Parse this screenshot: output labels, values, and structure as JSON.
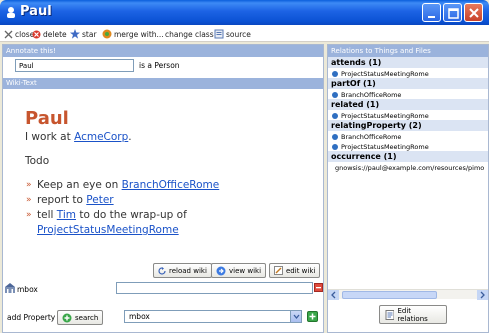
{
  "window": {
    "title": "Paul"
  },
  "toolbar": [
    {
      "label": "close",
      "icon": "close-icon"
    },
    {
      "label": "delete",
      "icon": "delete-icon"
    },
    {
      "label": "star",
      "icon": "star-icon"
    },
    {
      "label": "merge with...",
      "icon": "merge-icon"
    },
    {
      "label": "change class",
      "icon": ""
    },
    {
      "label": "source",
      "icon": "source-icon"
    }
  ],
  "annotate": {
    "header": "Annotate this!",
    "name_value": "Paul",
    "is_a": "is a Person"
  },
  "wiki": {
    "header": "Wiki-Text",
    "title": "Paul",
    "line_prefix": "I work at ",
    "line_link": "AcmeCorp",
    "line_suffix": ".",
    "todo": "Todo",
    "items": [
      {
        "prefix": "Keep an eye on ",
        "link": "BranchOfficeRome",
        "suffix": ""
      },
      {
        "prefix": "report to ",
        "link": "Peter",
        "suffix": ""
      },
      {
        "prefix": "tell ",
        "link": "Tim",
        "suffix": " to do the wrap-up of"
      }
    ],
    "continuation_link": "ProjectStatusMeetingRome",
    "buttons": {
      "reload": "reload wiki",
      "view": "view wiki",
      "edit": "edit wiki"
    }
  },
  "property": {
    "label": "mbox",
    "value": ""
  },
  "add_property": {
    "label": "add Property",
    "search": "search",
    "selected": "mbox"
  },
  "relations": {
    "header": "Relations to Things and Files",
    "groups": [
      {
        "name": "attends (1)",
        "items": [
          "ProjectStatusMeetingRome"
        ]
      },
      {
        "name": "partOf (1)",
        "items": [
          "BranchOfficeRome"
        ]
      },
      {
        "name": "related (1)",
        "items": [
          "ProjectStatusMeetingRome"
        ]
      },
      {
        "name": "relatingProperty (2)",
        "items": [
          "BranchOfficeRome",
          "ProjectStatusMeetingRome"
        ]
      },
      {
        "name": "occurrence (1)",
        "items": [
          "gnowsis://paul@example.com/resources/pimo"
        ]
      }
    ],
    "edit_label": "Edit relations"
  },
  "colors": {
    "title_bar": "#0b52d4",
    "header": "#9bb3dc",
    "wiki_title": "#c7552e",
    "link": "#1a52c8"
  }
}
